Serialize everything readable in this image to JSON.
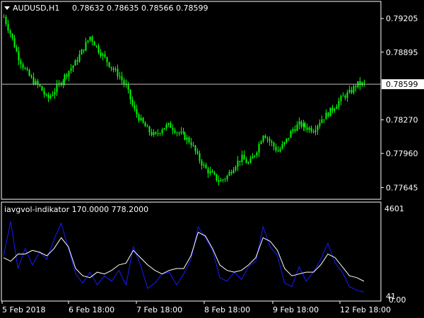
{
  "window": {
    "symbol_label": "AUDUSD,H1",
    "ohlc_label": "0.78632 0.78635 0.78566 0.78599",
    "indicator_label": "iavgvol-indikator 170.0000 778.2000"
  },
  "colors": {
    "background": "#000000",
    "frame": "#ffffff",
    "candle": "#00ff00",
    "fast_line": "#1a1aff",
    "slow_line": "#ffffff",
    "current_price_line": "#c0c0c0"
  },
  "price_axis": {
    "ticks": [
      "0.79205",
      "0.78895",
      "0.78270",
      "0.77960",
      "0.77645"
    ],
    "current_price": "0.78599"
  },
  "indicator_axis": {
    "top_label": "4601",
    "bottom_label": "41",
    "bottom_overlap_label": "0.00"
  },
  "time_axis": {
    "labels": [
      "5 Feb 2018",
      "6 Feb 18:00",
      "7 Feb 18:00",
      "8 Feb 18:00",
      "9 Feb 18:00",
      "12 Feb 18:00"
    ]
  },
  "chart_data": [
    {
      "type": "candlestick",
      "title": "AUDUSD,H1",
      "ylim": [
        0.7755,
        0.7935
      ],
      "ticks": [
        0.79205,
        0.78895,
        0.7827,
        0.7796,
        0.77645
      ],
      "current_price": 0.78599,
      "x_labels": [
        "5 Feb 2018",
        "6 Feb 18:00",
        "7 Feb 18:00",
        "8 Feb 18:00",
        "9 Feb 18:00",
        "12 Feb 18:00"
      ],
      "close_path": [
        [
          0,
          0.7922
        ],
        [
          4,
          0.7905
        ],
        [
          8,
          0.7885
        ],
        [
          12,
          0.7872
        ],
        [
          16,
          0.7863
        ],
        [
          20,
          0.7857
        ],
        [
          24,
          0.7846
        ],
        [
          28,
          0.7854
        ],
        [
          32,
          0.7863
        ],
        [
          36,
          0.7872
        ],
        [
          40,
          0.788
        ],
        [
          44,
          0.7892
        ],
        [
          48,
          0.7904
        ],
        [
          52,
          0.7893
        ],
        [
          56,
          0.7884
        ],
        [
          60,
          0.7875
        ],
        [
          64,
          0.7868
        ],
        [
          68,
          0.7857
        ],
        [
          72,
          0.7837
        ],
        [
          76,
          0.7826
        ],
        [
          80,
          0.7817
        ],
        [
          84,
          0.7812
        ],
        [
          88,
          0.782
        ],
        [
          92,
          0.7822
        ],
        [
          96,
          0.7816
        ],
        [
          100,
          0.7812
        ],
        [
          104,
          0.7806
        ],
        [
          108,
          0.7792
        ],
        [
          112,
          0.7782
        ],
        [
          116,
          0.7776
        ],
        [
          120,
          0.777
        ],
        [
          124,
          0.7775
        ],
        [
          128,
          0.7785
        ],
        [
          132,
          0.7792
        ],
        [
          136,
          0.7786
        ],
        [
          140,
          0.7798
        ],
        [
          144,
          0.7815
        ],
        [
          148,
          0.7806
        ],
        [
          152,
          0.7798
        ],
        [
          156,
          0.7806
        ],
        [
          160,
          0.7818
        ],
        [
          164,
          0.7823
        ],
        [
          168,
          0.782
        ],
        [
          172,
          0.7818
        ],
        [
          176,
          0.7827
        ],
        [
          180,
          0.7833
        ],
        [
          184,
          0.784
        ],
        [
          188,
          0.7848
        ],
        [
          192,
          0.7852
        ],
        [
          196,
          0.786
        ],
        [
          200,
          0.786
        ]
      ]
    },
    {
      "type": "line",
      "title": "iavgvol-indikator 170.0000 778.2000",
      "ylim": [
        41,
        4601
      ],
      "series": [
        {
          "name": "170.0000",
          "color": "#1a1aff",
          "x": [
            0,
            4,
            8,
            12,
            16,
            20,
            24,
            28,
            32,
            36,
            40,
            44,
            48,
            52,
            56,
            60,
            64,
            68,
            72,
            76,
            80,
            84,
            88,
            92,
            96,
            100,
            104,
            108,
            112,
            116,
            120,
            124,
            128,
            132,
            136,
            140,
            144,
            148,
            152,
            156,
            160,
            164,
            168,
            172,
            176,
            180,
            184,
            188,
            192,
            196,
            200
          ],
          "values": [
            2300,
            4200,
            1600,
            2700,
            1800,
            2500,
            2100,
            3200,
            4100,
            2700,
            1300,
            800,
            1400,
            700,
            1200,
            900,
            1500,
            700,
            2800,
            1800,
            500,
            800,
            1300,
            1400,
            700,
            1300,
            2100,
            3900,
            3300,
            2600,
            1100,
            900,
            1400,
            1000,
            1700,
            2000,
            3900,
            2800,
            2300,
            800,
            600,
            1700,
            900,
            1400,
            2100,
            3000,
            1900,
            1400,
            600,
            400,
            300
          ]
        },
        {
          "name": "778.2000",
          "color": "#ffffff",
          "x": [
            0,
            4,
            8,
            12,
            16,
            20,
            24,
            28,
            32,
            36,
            40,
            44,
            48,
            52,
            56,
            60,
            64,
            68,
            72,
            76,
            80,
            84,
            88,
            92,
            96,
            100,
            104,
            108,
            112,
            116,
            120,
            124,
            128,
            132,
            136,
            140,
            144,
            148,
            152,
            156,
            160,
            164,
            168,
            172,
            176,
            180,
            184,
            188,
            192,
            196,
            200
          ],
          "values": [
            2200,
            2000,
            2400,
            2400,
            2600,
            2500,
            2300,
            2700,
            3300,
            2800,
            1600,
            1200,
            1100,
            1400,
            1300,
            1500,
            1800,
            1900,
            2600,
            2200,
            1800,
            1500,
            1300,
            1500,
            1600,
            1600,
            2300,
            3600,
            3400,
            2700,
            1800,
            1500,
            1400,
            1500,
            1800,
            2200,
            3300,
            3100,
            2600,
            1600,
            1200,
            1300,
            1400,
            1400,
            1800,
            2400,
            2200,
            1700,
            1200,
            1100,
            900
          ]
        }
      ]
    }
  ]
}
